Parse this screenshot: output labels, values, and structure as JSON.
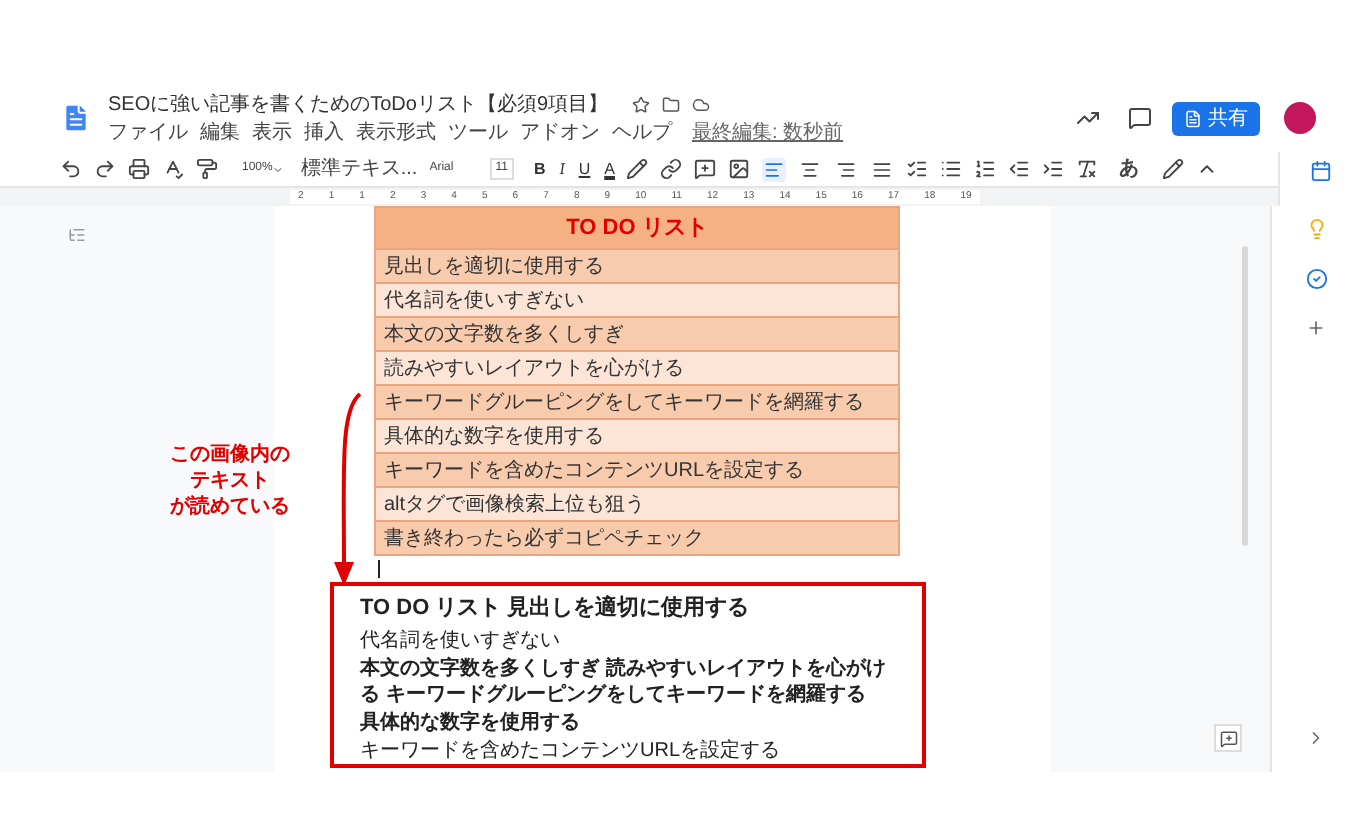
{
  "document": {
    "title": "SEOに強い記事を書くためのToDoリスト【必須9項目】",
    "menu": [
      "ファイル",
      "編集",
      "表示",
      "挿入",
      "表示形式",
      "ツール",
      "アドオン",
      "ヘルプ"
    ],
    "last_edit": "最終編集: 数秒前"
  },
  "share_button": "共有",
  "toolbar": {
    "zoom": "100%",
    "style": "標準テキス...",
    "font": "Arial",
    "font_size": "11",
    "format_buttons": [
      "B",
      "I",
      "U",
      "A"
    ],
    "alignment": [
      {
        "selected": true
      },
      {
        "selected": false
      },
      {
        "selected": false
      },
      {
        "selected": false
      }
    ],
    "input_tool": "あ"
  },
  "ruler": [
    "2",
    "1",
    "1",
    "2",
    "3",
    "4",
    "5",
    "6",
    "7",
    "8",
    "9",
    "10",
    "11",
    "12",
    "13",
    "14",
    "15",
    "16",
    "17",
    "18",
    "19"
  ],
  "table": {
    "title": "TO DO リスト",
    "rows": [
      "見出しを適切に使用する",
      "代名詞を使いすぎない",
      "本文の文字数を多くしすぎ",
      "読みやすいレイアウトを心がける",
      "キーワードグルーピングをしてキーワードを網羅する",
      "具体的な数字を使用する",
      "キーワードを含めたコンテンツURLを設定する",
      "altタグで画像検索上位も狙う",
      "書き終わったら必ずコピペチェック"
    ]
  },
  "annotation": [
    "この画像内の",
    "テキスト",
    "が読めている"
  ],
  "extracted_text": {
    "heading": "TO DO リスト 見出しを適切に使用する",
    "paragraphs": [
      {
        "kind": "small",
        "text": "代名詞を使いすぎない"
      },
      {
        "kind": "normal",
        "text": "本文の文字数を多くしすぎ 読みやすいレイアウトを心がける キーワードグルーピングをしてキーワードを網羅する"
      },
      {
        "kind": "normal",
        "text": "具体的な数字を使用する"
      },
      {
        "kind": "small",
        "text": "キーワードを含めたコンテンツURLを設定する"
      }
    ]
  }
}
